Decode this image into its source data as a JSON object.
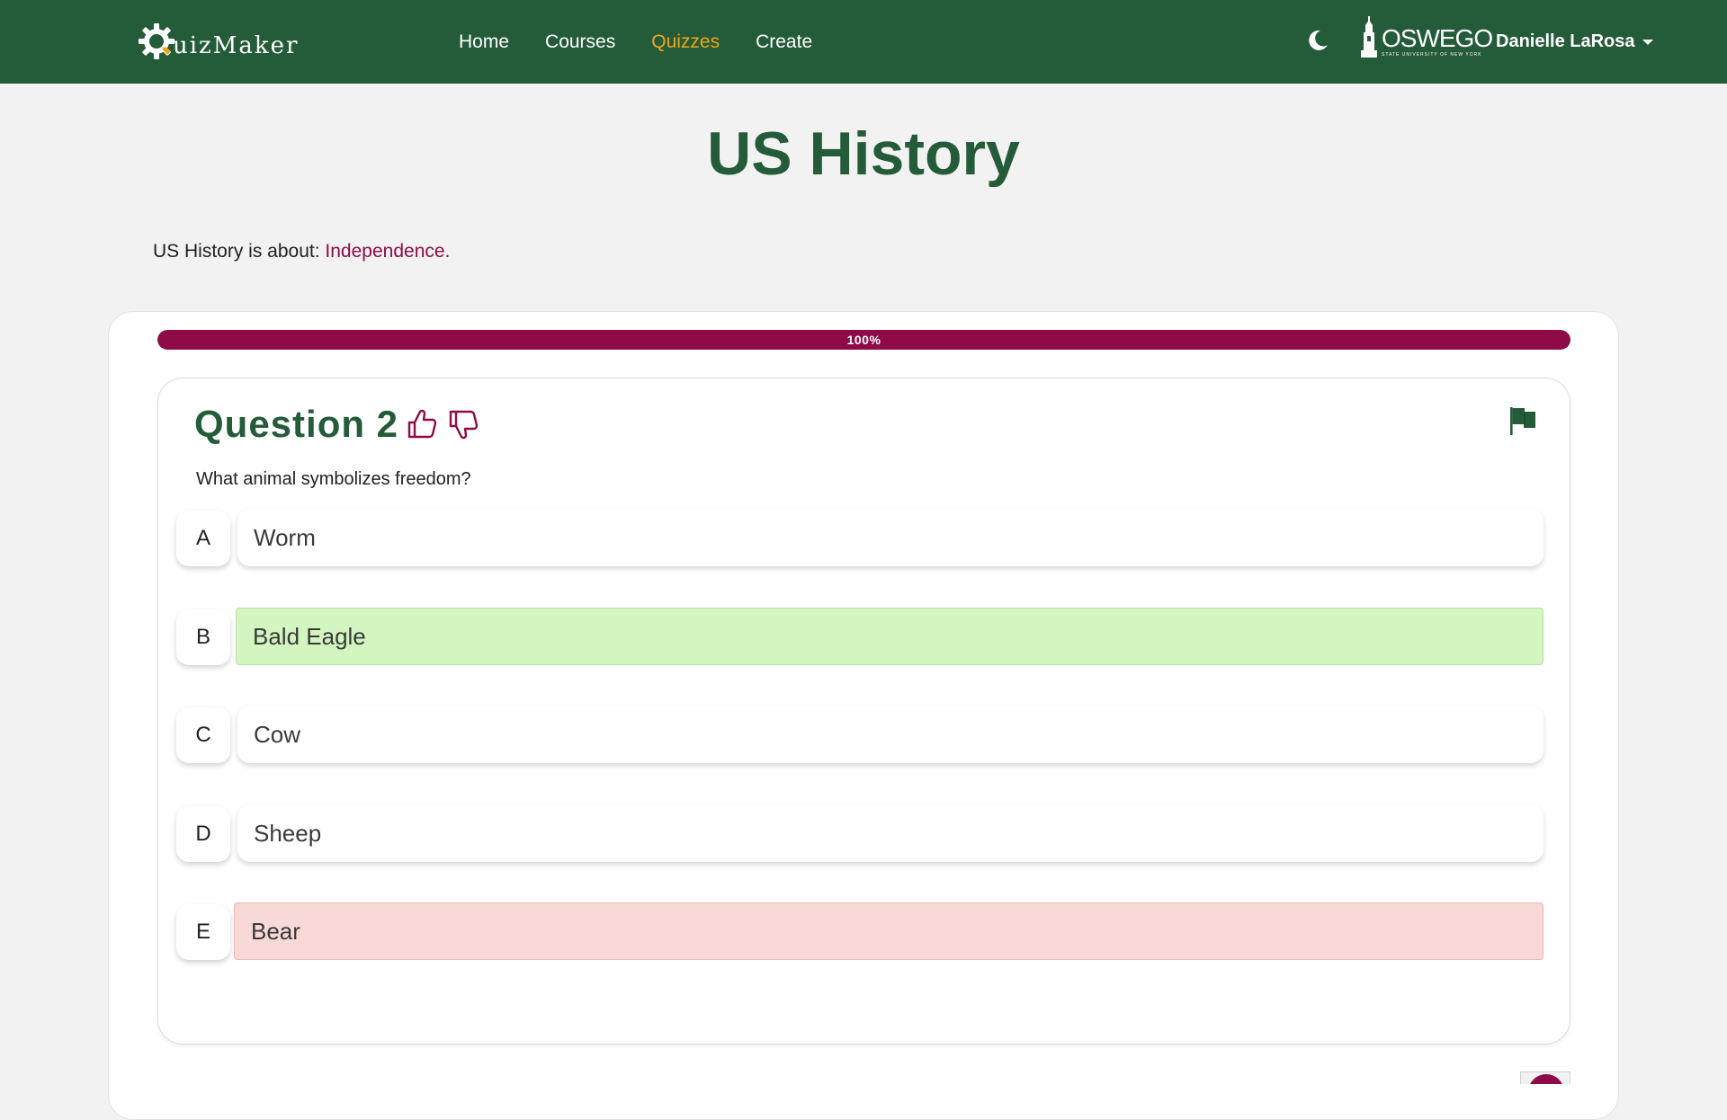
{
  "navbar": {
    "logo_text": "uizMaker",
    "links": [
      {
        "label": "Home",
        "active": false
      },
      {
        "label": "Courses",
        "active": false
      },
      {
        "label": "Quizzes",
        "active": true
      },
      {
        "label": "Create",
        "active": false
      }
    ],
    "oswego_word": "OSWEGO",
    "oswego_sub": "STATE UNIVERSITY OF NEW YORK",
    "user_name": "Danielle LaRosa",
    "icons": {
      "theme": "moon-icon",
      "logo": "gear-icon",
      "school": "tower-icon"
    }
  },
  "page": {
    "title": "US History",
    "about_prefix": "US History is about:",
    "about_topic": "Independence."
  },
  "progress": {
    "value": 1.0,
    "label": "100%"
  },
  "question": {
    "title": "Question 2",
    "text": "What animal symbolizes freedom?",
    "options": [
      {
        "letter": "A",
        "text": "Worm",
        "state": "none"
      },
      {
        "letter": "B",
        "text": "Bald Eagle",
        "state": "correct"
      },
      {
        "letter": "C",
        "text": "Cow",
        "state": "none"
      },
      {
        "letter": "D",
        "text": "Sheep",
        "state": "none"
      },
      {
        "letter": "E",
        "text": "Bear",
        "state": "wrong"
      }
    ]
  },
  "colors": {
    "primary_green": "#245b38",
    "accent_maroon": "#8f0b48",
    "active_link": "#f0a818",
    "correct_bg": "#d3f6c1",
    "wrong_bg": "#f9d8d8",
    "page_bg": "#f2f2f2"
  }
}
